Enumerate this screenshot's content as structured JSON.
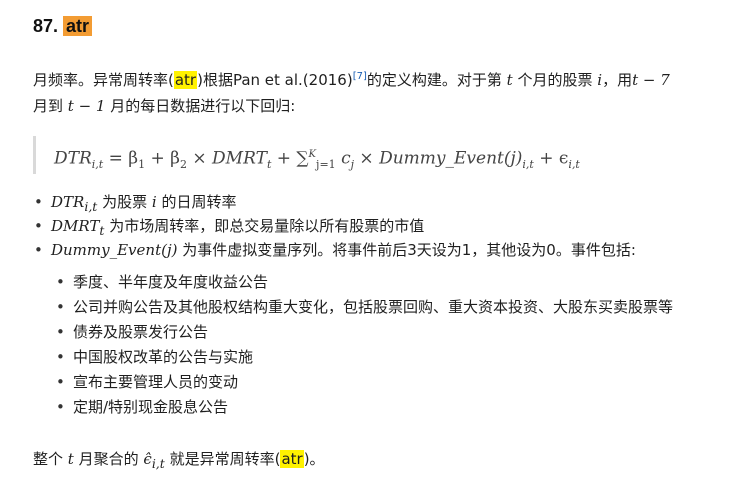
{
  "heading": {
    "number": "87.",
    "keyword": "atr"
  },
  "intro": {
    "part1": "月频率。异常周转率(",
    "kw": "atr",
    "part2": ")根据Pan et al.(2016)",
    "ref": "[7]",
    "part3": "的定义构建。对于第",
    "t": "t",
    "part4": "个月的股票",
    "i": "i",
    "part5": "，用",
    "range1": "t − 7",
    "line2a": "月到",
    "range2": "t − 1",
    "line2b": "月的每日数据进行以下回归:"
  },
  "formula": {
    "lhs": "DTR",
    "lhs_sub": "i,t",
    "eq": " = β",
    "b1sub": "1",
    "plus1": " + β",
    "b2sub": "2",
    "times1": " × DMRT",
    "dmsub": "t",
    "plus2": " + ∑",
    "sum_sup": "K",
    "sum_sub": "j=1",
    "cj": " c",
    "cjsub": "j",
    "times2": " × Dummy_Event(j)",
    "evsub": "i,t",
    "plus3": " + ϵ",
    "epssub": "i,t"
  },
  "bullets": [
    {
      "math": "DTR",
      "sub": "i,t",
      "text1": " 为股票 ",
      "mid": "i",
      "text2": " 的日周转率"
    },
    {
      "math": "DMRT",
      "sub": "t",
      "text1": " 为市场周转率，即总交易量除以所有股票的市值"
    },
    {
      "math": "Dummy_Event(j)",
      "text1": " 为事件虚拟变量序列。将事件前后3天设为1，其他设为0。事件包括:"
    }
  ],
  "events": [
    "季度、半年度及年度收益公告",
    "公司并购公告及其他股权结构重大变化，包括股票回购、重大资本投资、大股东买卖股票等",
    "债券及股票发行公告",
    "中国股权改革的公告与实施",
    "宣布主要管理人员的变动",
    "定期/特别现金股息公告"
  ],
  "final": {
    "part1": "整个",
    "t": "t",
    "part2": "月聚合的",
    "eps": "ϵ̂",
    "epssub": "i,t",
    "part3": "就是异常周转率(",
    "kw": "atr",
    "part4": ")。"
  }
}
